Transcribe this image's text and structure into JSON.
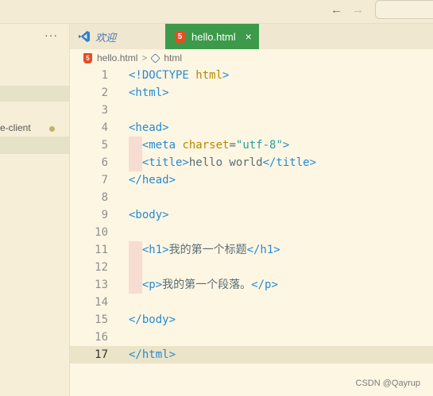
{
  "titlebar": {
    "back_arrow": "←",
    "forward_arrow": "→"
  },
  "sidebar": {
    "more_label": "···",
    "item_label": "e-client"
  },
  "tabs": {
    "welcome_label": "欢迎",
    "active_label": "hello.html",
    "html5_badge": "5",
    "close_label": "×"
  },
  "breadcrumb": {
    "file": "hello.html",
    "separator": ">",
    "symbol": "html"
  },
  "editor": {
    "current_line": 17,
    "lines": [
      {
        "num": "1",
        "tokens": [
          [
            "tag",
            "<!DOCTYPE "
          ],
          [
            "attr",
            "html"
          ],
          [
            "tag",
            ">"
          ]
        ]
      },
      {
        "num": "2",
        "tokens": [
          [
            "tag",
            "<html>"
          ]
        ]
      },
      {
        "num": "3",
        "tokens": []
      },
      {
        "num": "4",
        "tokens": [
          [
            "tag",
            "<head>"
          ]
        ]
      },
      {
        "num": "5",
        "indent": true,
        "tokens": [
          [
            "tag",
            "  <meta "
          ],
          [
            "attr",
            "charset"
          ],
          [
            "pun",
            "="
          ],
          [
            "str",
            "\"utf-8\""
          ],
          [
            "tag",
            ">"
          ]
        ]
      },
      {
        "num": "6",
        "indent": true,
        "tokens": [
          [
            "tag",
            "  <title>"
          ],
          [
            "pun",
            "hello world"
          ],
          [
            "tag",
            "</title>"
          ]
        ]
      },
      {
        "num": "7",
        "tokens": [
          [
            "tag",
            "</head>"
          ]
        ]
      },
      {
        "num": "8",
        "tokens": []
      },
      {
        "num": "9",
        "tokens": [
          [
            "tag",
            "<body>"
          ]
        ]
      },
      {
        "num": "10",
        "tokens": []
      },
      {
        "num": "11",
        "indent": true,
        "tokens": [
          [
            "tag",
            "  <h1>"
          ],
          [
            "pun",
            "我的第一个标题"
          ],
          [
            "tag",
            "</h1>"
          ]
        ]
      },
      {
        "num": "12",
        "indent": true,
        "tokens": []
      },
      {
        "num": "13",
        "indent": true,
        "tokens": [
          [
            "tag",
            "  <p>"
          ],
          [
            "pun",
            "我的第一个段落。"
          ],
          [
            "tag",
            "</p>"
          ]
        ]
      },
      {
        "num": "14",
        "tokens": []
      },
      {
        "num": "15",
        "tokens": [
          [
            "tag",
            "</body>"
          ]
        ]
      },
      {
        "num": "16",
        "tokens": []
      },
      {
        "num": "17",
        "tokens": [
          [
            "tag",
            "</html>"
          ]
        ]
      }
    ]
  },
  "watermark": "CSDN @Qayrup",
  "colors": {
    "active_tab": "#3c9a4a",
    "tag": "#268bd2",
    "attribute": "#b58900",
    "string": "#2aa198",
    "html5_icon": "#e44d26"
  }
}
